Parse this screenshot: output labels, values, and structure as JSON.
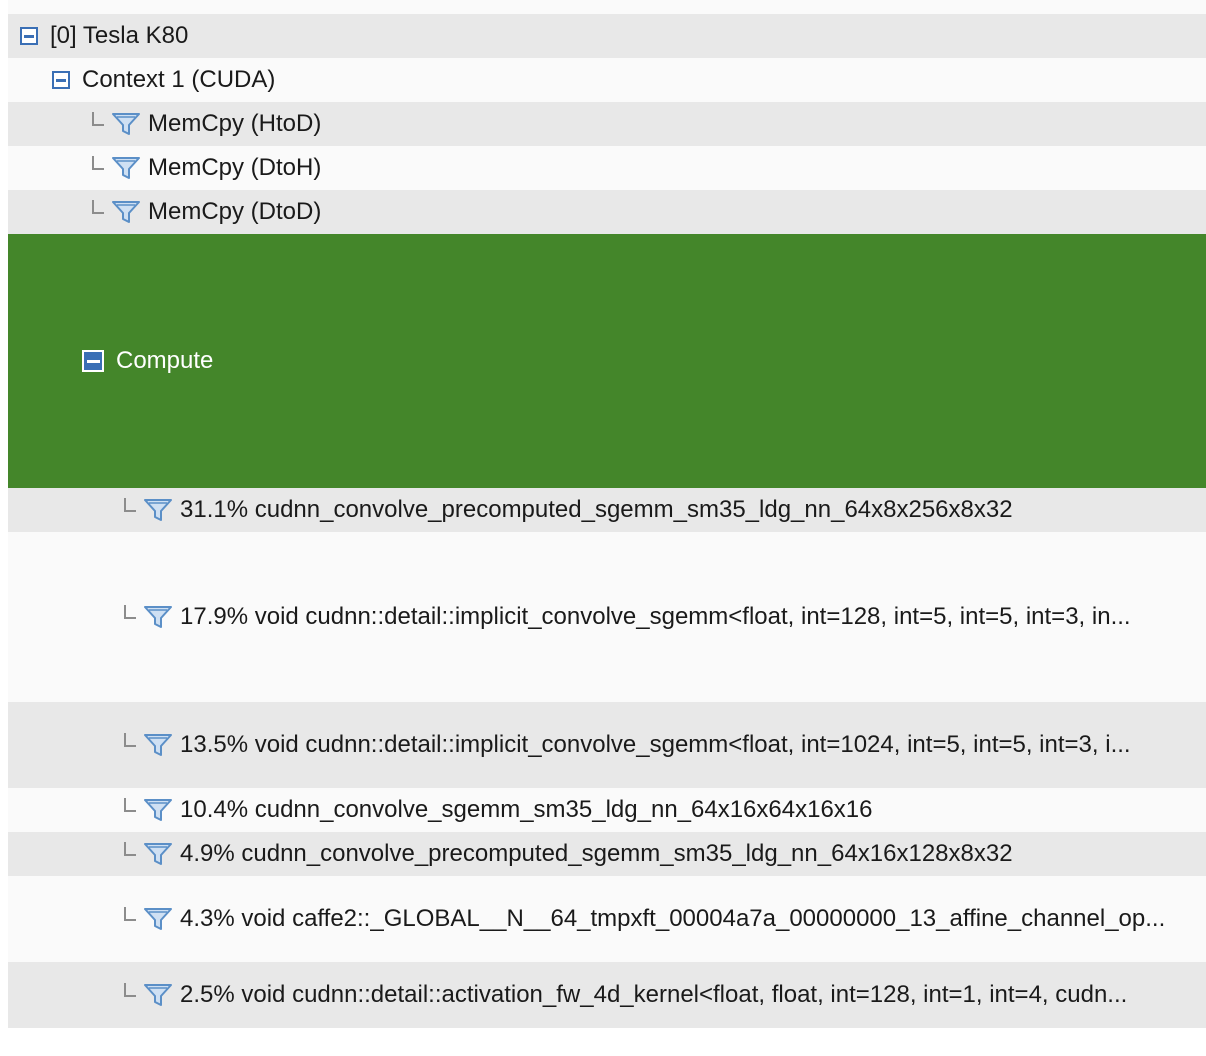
{
  "tree": {
    "device": {
      "label": "[0] Tesla K80"
    },
    "context": {
      "label": "Context 1 (CUDA)"
    },
    "memcpy": [
      {
        "label": "MemCpy (HtoD)"
      },
      {
        "label": "MemCpy (DtoH)"
      },
      {
        "label": "MemCpy (DtoD)"
      }
    ],
    "compute": {
      "label": "Compute"
    },
    "kernels": [
      {
        "label": "31.1% cudnn_convolve_precomputed_sgemm_sm35_ldg_nn_64x8x256x8x32"
      },
      {
        "label": "17.9% void cudnn::detail::implicit_convolve_sgemm<float, int=128, int=5, int=5, int=3, in..."
      },
      {
        "label": "13.5% void cudnn::detail::implicit_convolve_sgemm<float, int=1024, int=5, int=5, int=3, i..."
      },
      {
        "label": "10.4% cudnn_convolve_sgemm_sm35_ldg_nn_64x16x64x16x16"
      },
      {
        "label": "4.9% cudnn_convolve_precomputed_sgemm_sm35_ldg_nn_64x16x128x8x32"
      },
      {
        "label": "4.3% void caffe2::_GLOBAL__N__64_tmpxft_00004a7a_00000000_13_affine_channel_op..."
      },
      {
        "label": "2.5% void cudnn::detail::activation_fw_4d_kernel<float, float, int=128, int=1, int=4, cudn..."
      }
    ]
  },
  "icons": {
    "toggle": "collapse-minus-icon",
    "filter": "funnel-filter-icon",
    "connector": "tree-connector"
  },
  "colors": {
    "selected_row": "#44862a",
    "alt_row": "#e8e8e8",
    "plain_row": "#fafafa",
    "toggle_blue": "#3a6fb5",
    "funnel_blue": "#5b8fc7"
  }
}
